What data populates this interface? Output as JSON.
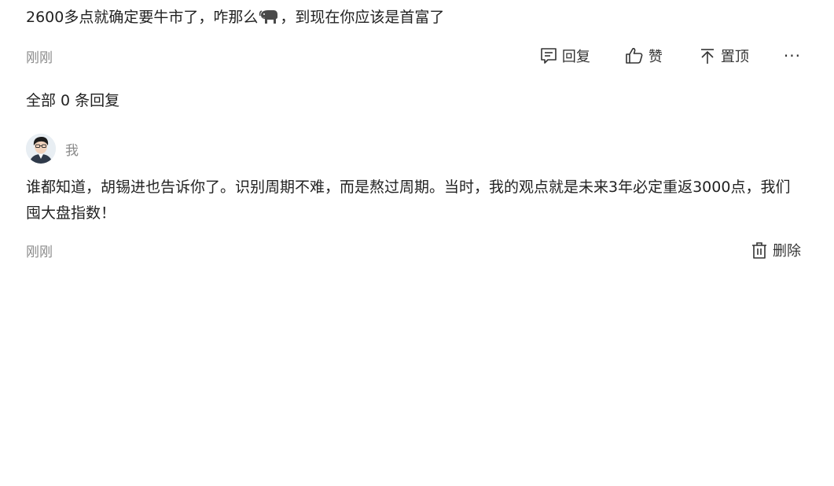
{
  "comment": {
    "text_before_emoji": "2600多点就确定要牛市了，咋那么",
    "emoji": "bull-emoji-icon",
    "text_after_emoji": "，到现在你应该是首富了",
    "time": "刚刚",
    "actions": {
      "reply": "回复",
      "like": "赞",
      "pin": "置顶",
      "more": "···"
    }
  },
  "replies_header": "全部 0 条回复",
  "reply": {
    "username": "我",
    "text": "谁都知道，胡锡进也告诉你了。识别周期不难，而是熬过周期。当时，我的观点就是未来3年必定重返3000点，我们囤大盘指数！",
    "time": "刚刚",
    "delete": "删除"
  }
}
